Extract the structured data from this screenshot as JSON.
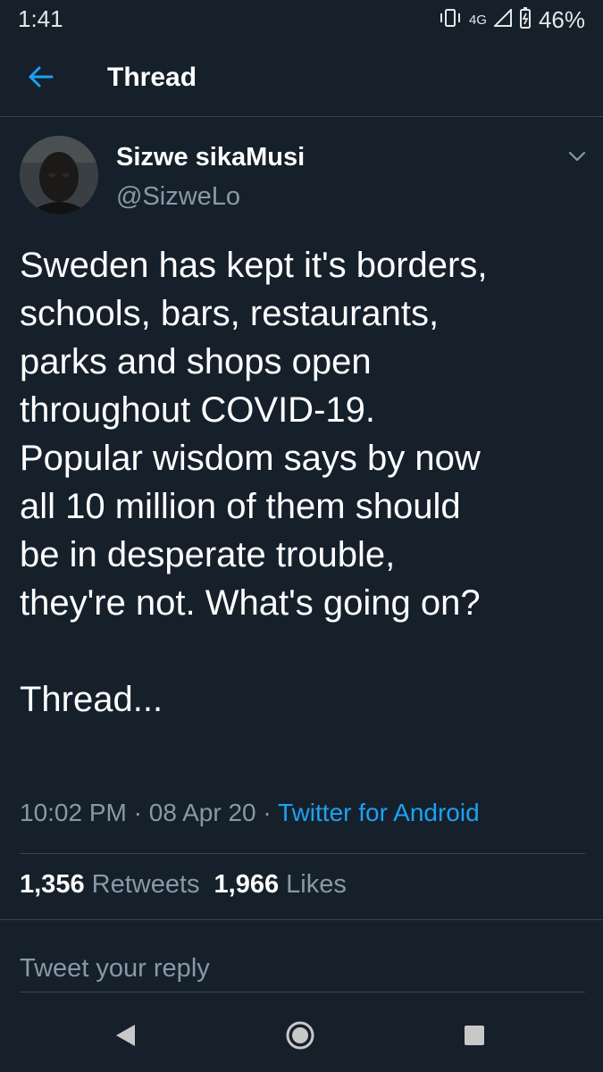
{
  "status_bar": {
    "time": "1:41",
    "network": "4G",
    "battery": "46%"
  },
  "header": {
    "title": "Thread"
  },
  "tweet": {
    "author_name": "Sizwe sikaMusi",
    "author_handle": "@SizweLo",
    "text": "Sweden has kept it's borders,\nschools, bars, restaurants,\nparks and shops open\nthroughout COVID-19.\nPopular wisdom says by now\nall 10 million of them should\nbe in desperate trouble,\nthey're not. What's going on?\n\nThread...",
    "time": "10:02 PM",
    "date": "08 Apr 20",
    "separator": "·",
    "source": "Twitter for Android"
  },
  "stats": {
    "retweets_count": "1,356",
    "retweets_label": "Retweets",
    "likes_count": "1,966",
    "likes_label": "Likes"
  },
  "reply": {
    "placeholder": "Tweet your reply"
  },
  "colors": {
    "background": "#15202b",
    "accent": "#1da1f2",
    "secondary_text": "#8899a6",
    "divider": "#38444d"
  },
  "icons": {
    "back": "arrow-left-icon",
    "caret": "chevron-down-icon",
    "nav_back": "triangle-back-icon",
    "nav_home": "circle-home-icon",
    "nav_recents": "square-recents-icon"
  }
}
